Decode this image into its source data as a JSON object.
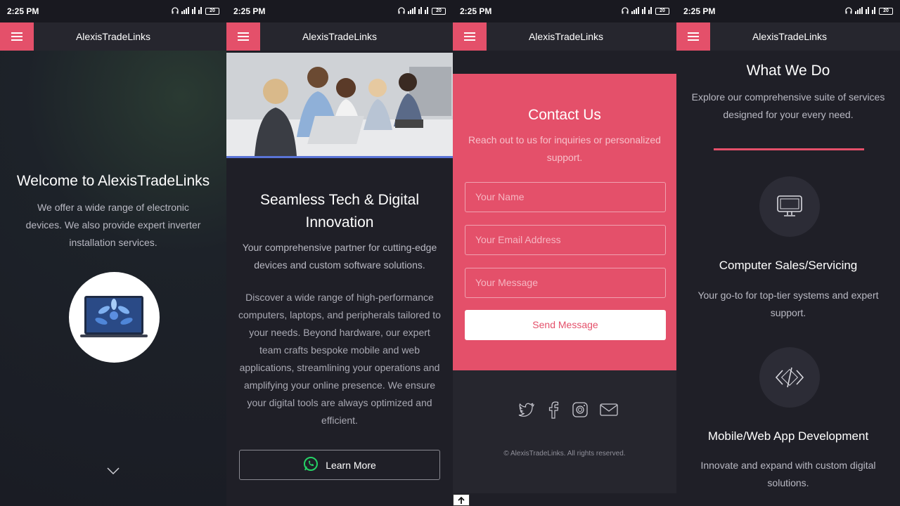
{
  "status_bar": {
    "time": "2:25 PM",
    "battery": "20"
  },
  "app": {
    "title": "AlexisTradeLinks"
  },
  "panel1": {
    "heading": "Welcome to AlexisTradeLinks",
    "description_lines": [
      "We offer a wide range of electronic",
      "devices. We also provide expert inverter",
      "installation services."
    ],
    "icons": {
      "menu": "hamburger-icon",
      "laptop": "laptop-image",
      "scroll": "chevron-down-icon"
    }
  },
  "panel2": {
    "heading_lines": [
      "Seamless Tech & Digital",
      "Innovation"
    ],
    "subtitle_lines": [
      "Your comprehensive partner for cutting-edge",
      "devices and custom software solutions."
    ],
    "body_lines": [
      "Discover a wide range of high-performance",
      "computers, laptops, and peripherals tailored to",
      "your needs. Beyond hardware, our expert",
      "team crafts bespoke mobile and web",
      "applications, streamlining your operations and",
      "amplifying your online presence. We ensure",
      "your digital tools are always optimized and",
      "efficient."
    ],
    "learn_more": "Learn More",
    "icons": {
      "whatsapp": "whatsapp-icon",
      "photo": "team-photo"
    }
  },
  "panel3": {
    "heading": "Contact Us",
    "subtitle_lines": [
      "Reach out to us for inquiries or personalized",
      "support."
    ],
    "name_placeholder": "Your Name",
    "email_placeholder": "Your Email Address",
    "message_placeholder": "Your Message",
    "send_label": "Send Message",
    "copyright": "© AlexisTradeLinks. All rights reserved.",
    "icons": [
      "twitter-icon",
      "facebook-icon",
      "instagram-icon",
      "mail-icon",
      "arrow-up-icon"
    ]
  },
  "panel4": {
    "heading": "What We Do",
    "subtitle_lines": [
      "Explore our comprehensive suite of services",
      "designed for your every need."
    ],
    "services": [
      {
        "title": "Computer Sales/Servicing",
        "desc_lines": [
          "Your go-to for top-tier systems and expert",
          "support."
        ],
        "icon": "monitor-icon"
      },
      {
        "title": "Mobile/Web App Development",
        "desc_lines": [
          "Innovate and expand with custom digital",
          "solutions."
        ],
        "icon": "code-icon"
      }
    ]
  },
  "colors": {
    "accent": "#e4506a",
    "background": "#1f1f27",
    "appbar": "#26262e"
  }
}
